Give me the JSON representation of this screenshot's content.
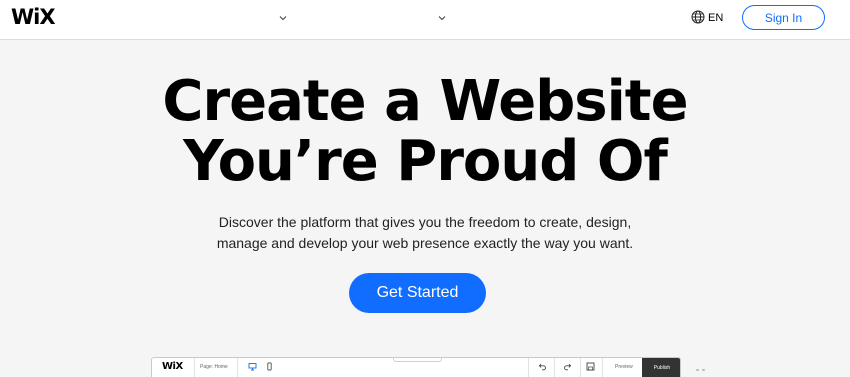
{
  "header": {
    "logo": "WiX",
    "language": "EN",
    "sign_in": "Sign In"
  },
  "hero": {
    "title_line1": "Create a Website",
    "title_line2": "You’re Proud Of",
    "subtitle_line1": "Discover the platform that gives you the freedom to create, design,",
    "subtitle_line2": "manage and develop your web presence exactly the way you want.",
    "cta": "Get Started"
  },
  "editor_preview": {
    "logo": "WiX",
    "page_selector": "Page: Home",
    "preview": "Preview",
    "publish": "Publish"
  },
  "colors": {
    "accent": "#116dff",
    "background": "#f5f5f5",
    "publish_bg": "#333333"
  },
  "icons": {
    "nav_chevron_1": "chevron-down-icon",
    "nav_chevron_2": "chevron-down-icon",
    "language": "globe-icon",
    "desktop": "desktop-icon",
    "mobile": "mobile-icon",
    "undo": "undo-icon",
    "redo": "redo-icon",
    "save": "save-icon"
  }
}
